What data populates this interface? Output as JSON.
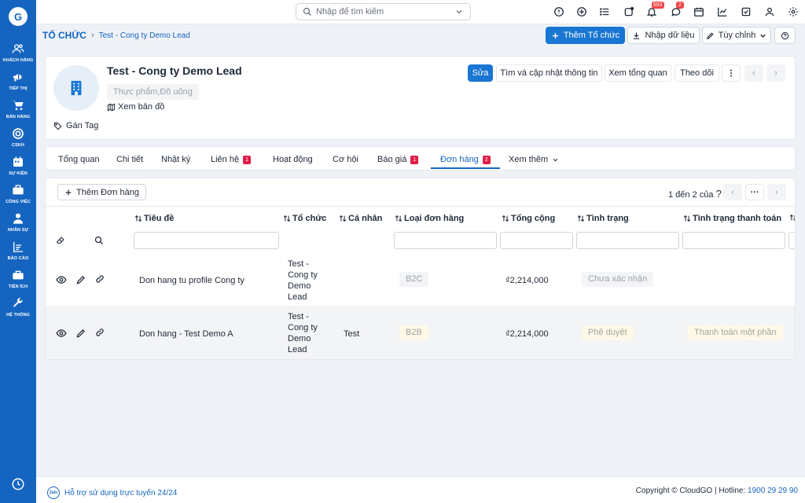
{
  "sidebar": {
    "logo": "G",
    "items": [
      {
        "label": "KHÁCH HÀNG",
        "icon": "users-icon"
      },
      {
        "label": "TIẾP THỊ",
        "icon": "megaphone-icon"
      },
      {
        "label": "BÁN HÀNG",
        "icon": "cart-icon"
      },
      {
        "label": "CSKH",
        "icon": "support-icon"
      },
      {
        "label": "SỰ KIỆN",
        "icon": "calendar-icon"
      },
      {
        "label": "CÔNG VIỆC",
        "icon": "briefcase-icon"
      },
      {
        "label": "NHÂN SỰ",
        "icon": "person-icon"
      },
      {
        "label": "BÁO CÁO",
        "icon": "report-icon"
      },
      {
        "label": "TIỆN ÍCH",
        "icon": "toolbox-icon"
      },
      {
        "label": "HỆ THỐNG",
        "icon": "wrench-icon"
      }
    ]
  },
  "topbar": {
    "search_placeholder": "Nhập để tìm kiếm",
    "notifications_count": "693",
    "messages_count": "2"
  },
  "header": {
    "breadcrumb_main": "TỔ CHỨC",
    "breadcrumb_sub": "Test - Cong ty Demo Lead",
    "add_org": "Thêm Tổ chức",
    "import": "Nhập dữ liệu",
    "customize": "Tùy chỉnh"
  },
  "profile": {
    "name": "Test - Cong ty Demo Lead",
    "industry": "Thực phẩm,Đồ uống",
    "map_link": "Xem bản đồ",
    "tag_link": "Gán Tag",
    "actions": {
      "edit": "Sửa",
      "lookup": "Tìm và cập nhật thông tin",
      "overview": "Xem tổng quan",
      "follow": "Theo dõi"
    }
  },
  "tabs": [
    {
      "label": "Tổng quan",
      "count": ""
    },
    {
      "label": "Chi tiết",
      "count": ""
    },
    {
      "label": "Nhật ký",
      "count": ""
    },
    {
      "label": "Liên hệ",
      "count": "1"
    },
    {
      "label": "Hoạt động",
      "count": ""
    },
    {
      "label": "Cơ hội",
      "count": ""
    },
    {
      "label": "Báo giá",
      "count": "1"
    },
    {
      "label": "Đơn hàng",
      "count": "2"
    },
    {
      "label": "Xem thêm",
      "count": ""
    }
  ],
  "orders": {
    "add_button": "Thêm Đơn hàng",
    "pager": "1 đến 2 của",
    "pager_q": "?",
    "columns": [
      "Tiêu đề",
      "Tổ chức",
      "Cá nhân",
      "Loại đơn hàng",
      "Tổng cộng",
      "Tình trạng",
      "Tình trạng thanh toán"
    ],
    "rows": [
      {
        "title": "Don hang tu profile Cong ty",
        "org": "Test - Cong ty Demo Lead",
        "person": "",
        "type": "B2C",
        "total": "₫2,214,000",
        "status": "Chưa xác nhận",
        "payment": ""
      },
      {
        "title": "Don hang - Test Demo A",
        "org": "Test - Cong ty Demo Lead",
        "person": "Test",
        "type": "B2B",
        "total": "₫2,214,000",
        "status": "Phê duyệt",
        "payment": "Thanh toán một phần"
      }
    ]
  },
  "footer": {
    "zalo": "Zalo",
    "support": "Hỗ trợ sử dụng trực tuyến 24/24",
    "copyright": "Copyright © CloudGO | Hotline: ",
    "hotline": "1900 29 29 90"
  }
}
